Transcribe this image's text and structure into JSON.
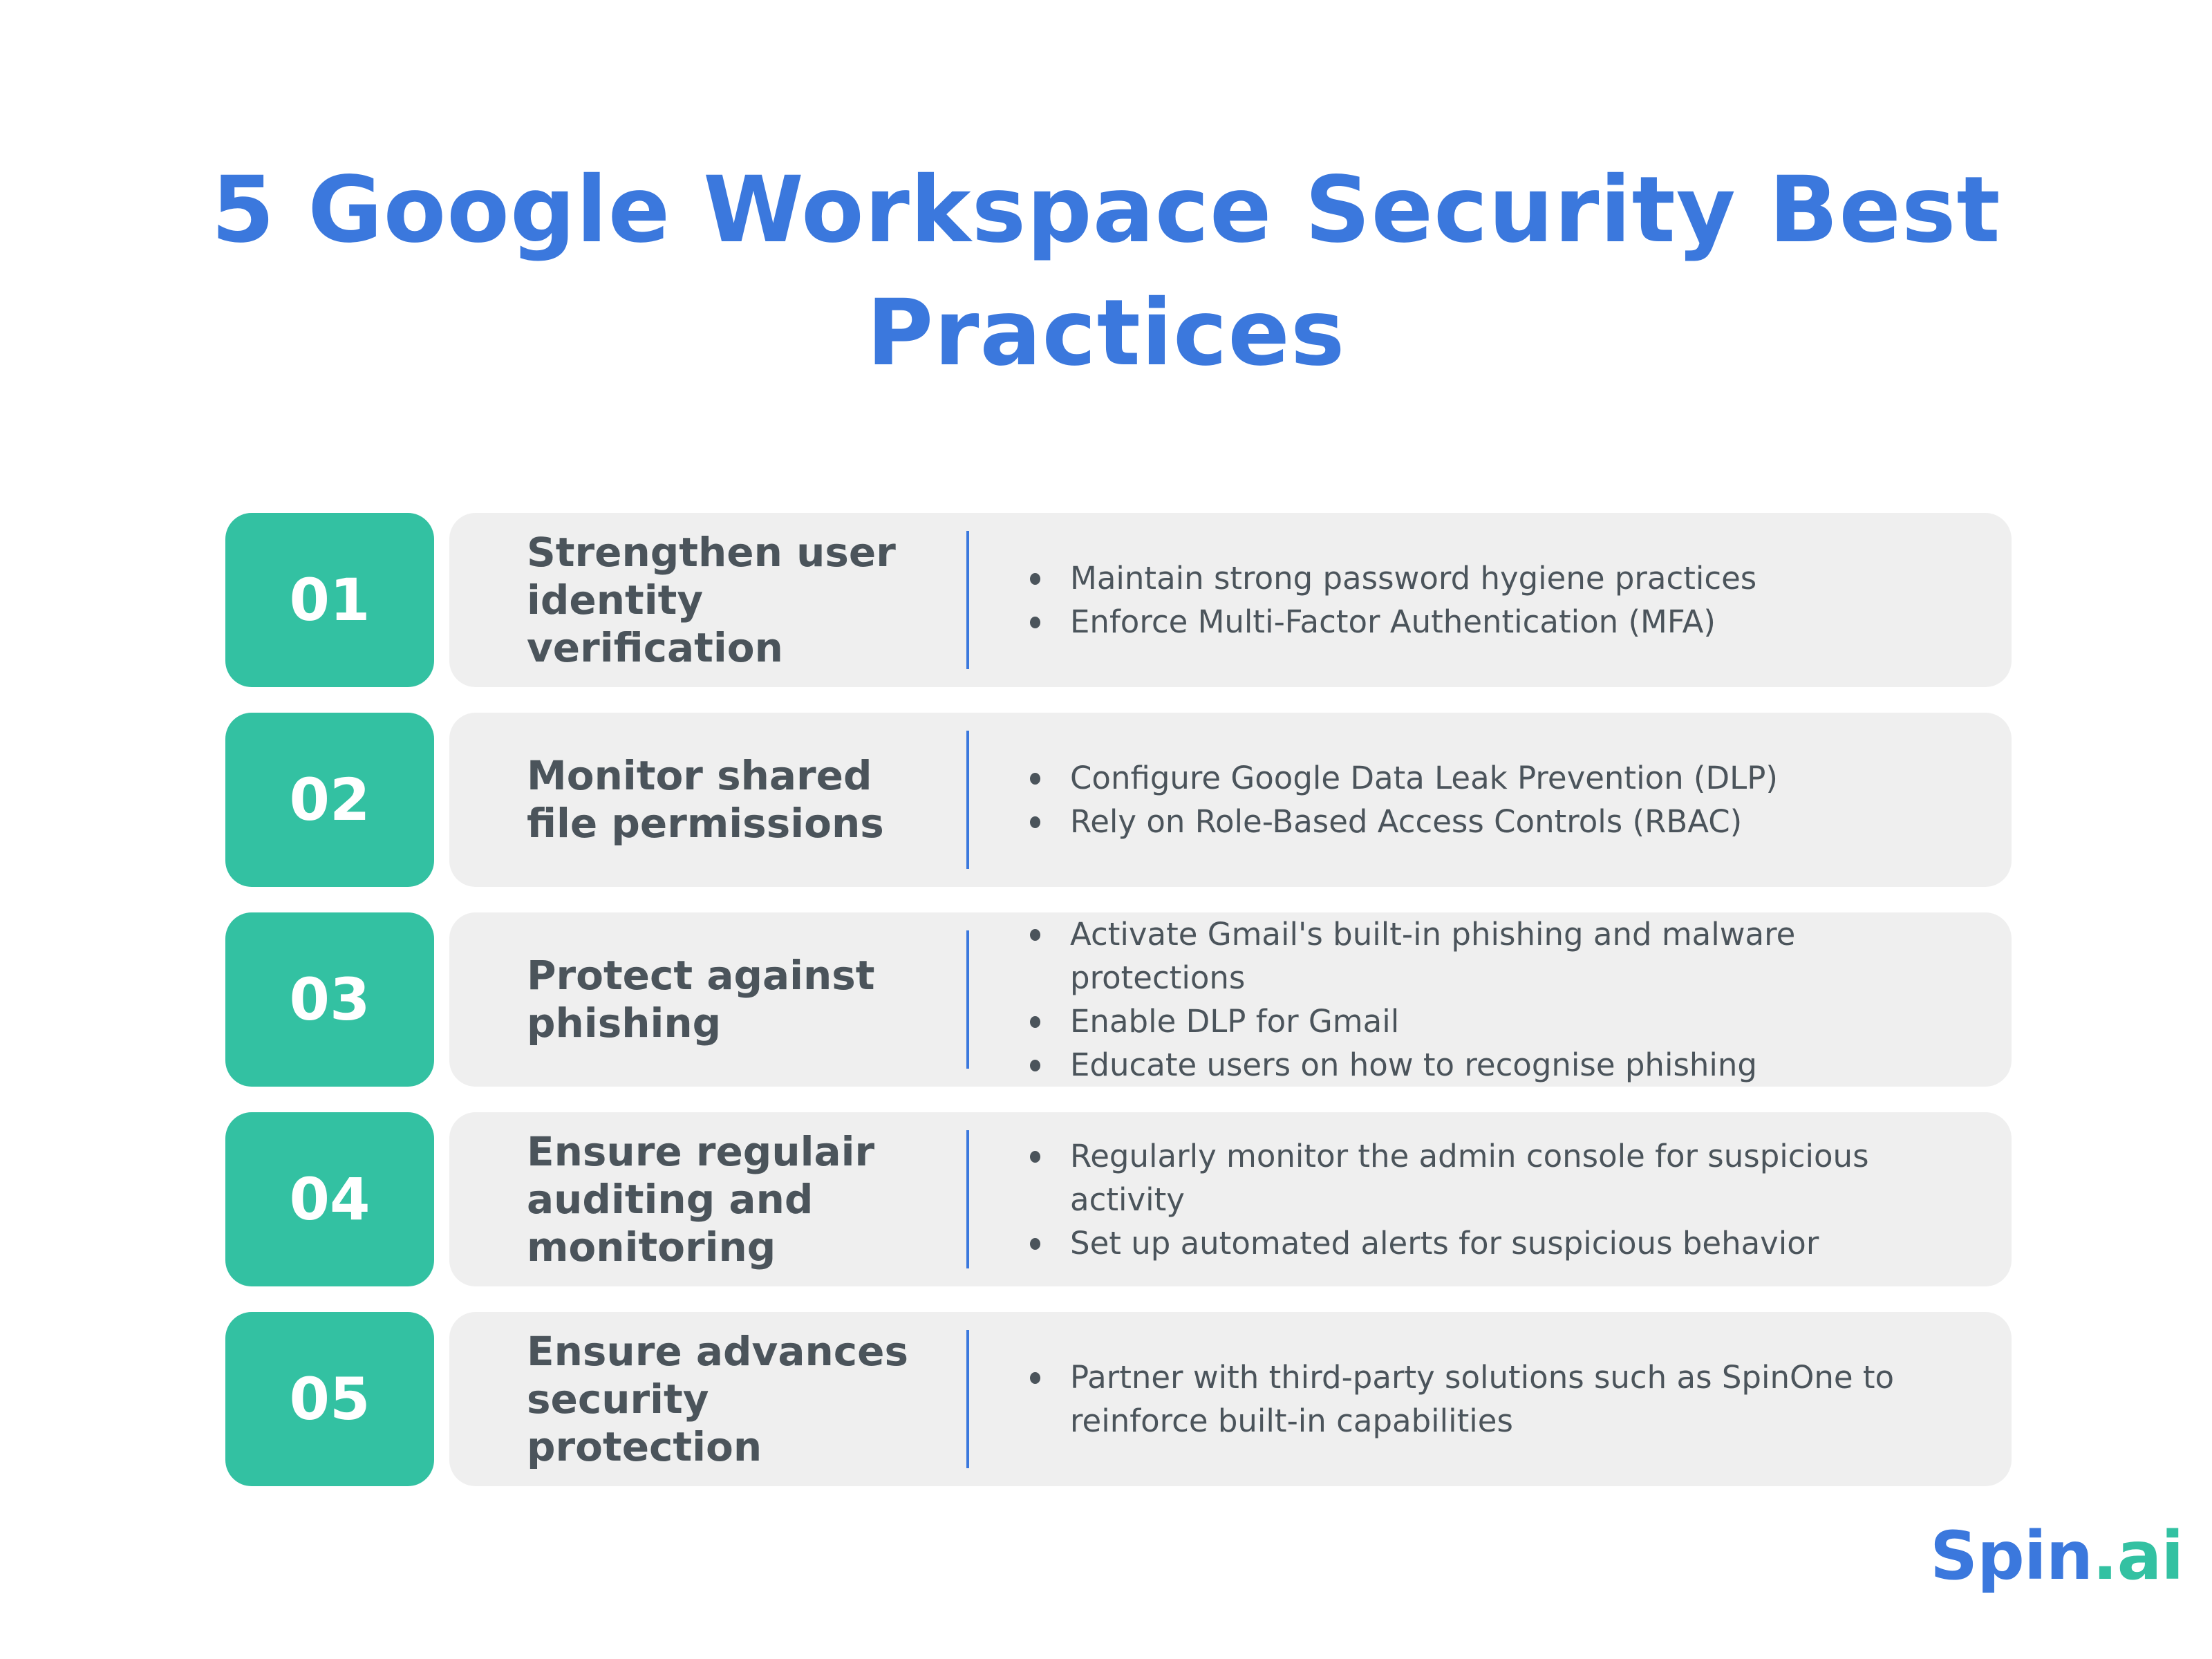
{
  "title": {
    "line1": "5 Google Workspace Security Best",
    "line2": "Practices"
  },
  "colors": {
    "accent_blue": "#3b78dd",
    "accent_green": "#33c1a2",
    "card_bg": "#efefef",
    "text_dark": "#4b545b"
  },
  "practices": [
    {
      "number": "01",
      "heading": "Strengthen user identity verification",
      "bullets": [
        "Maintain strong password hygiene practices",
        "Enforce Multi-Factor Authentication (MFA)"
      ]
    },
    {
      "number": "02",
      "heading": "Monitor shared file permissions",
      "bullets": [
        "Configure Google Data Leak Prevention (DLP)",
        "Rely on Role-Based Access Controls (RBAC)"
      ]
    },
    {
      "number": "03",
      "heading": "Protect against phishing",
      "bullets": [
        "Activate Gmail's built-in phishing and malware protections",
        "Enable DLP for Gmail",
        "Educate users on how to recognise phishing"
      ]
    },
    {
      "number": "04",
      "heading": "Ensure regulair auditing and monitoring",
      "bullets": [
        "Regularly monitor the admin console for suspicious activity",
        "Set up automated alerts for suspicious behavior"
      ]
    },
    {
      "number": "05",
      "heading": "Ensure advances security protection",
      "bullets": [
        "Partner with third-party solutions such as SpinOne to reinforce built-in capabilities"
      ]
    }
  ],
  "logo": {
    "part1": "Spin",
    "part2": ".ai"
  }
}
